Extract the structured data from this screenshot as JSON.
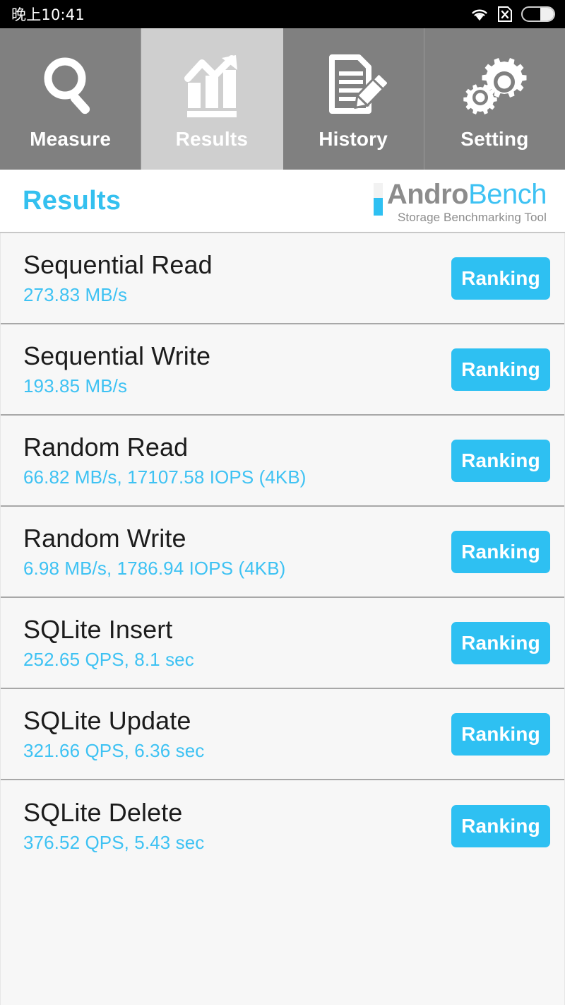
{
  "status_bar": {
    "clock": "晚上10:41",
    "icons": [
      "wifi-icon",
      "no-sim-icon",
      "battery-icon"
    ],
    "background": "#000000"
  },
  "tabs": [
    {
      "label": "Measure",
      "icon": "magnifier-icon",
      "selected": false
    },
    {
      "label": "Results",
      "icon": "bar-chart-arrow-icon",
      "selected": true
    },
    {
      "label": "History",
      "icon": "document-pencil-icon",
      "selected": false
    },
    {
      "label": "Setting",
      "icon": "gears-icon",
      "selected": false
    }
  ],
  "header": {
    "title": "Results",
    "brand_primary": "Andro",
    "brand_secondary": "Bench",
    "brand_subtitle": "Storage Benchmarking Tool"
  },
  "results": [
    {
      "name": "Sequential Read",
      "value": "273.83 MB/s",
      "button": "Ranking"
    },
    {
      "name": "Sequential Write",
      "value": "193.85 MB/s",
      "button": "Ranking"
    },
    {
      "name": "Random Read",
      "value": "66.82 MB/s, 17107.58 IOPS (4KB)",
      "button": "Ranking"
    },
    {
      "name": "Random Write",
      "value": "6.98 MB/s, 1786.94 IOPS (4KB)",
      "button": "Ranking"
    },
    {
      "name": "SQLite Insert",
      "value": "252.65 QPS, 8.1 sec",
      "button": "Ranking"
    },
    {
      "name": "SQLite Update",
      "value": "321.66 QPS, 6.36 sec",
      "button": "Ranking"
    },
    {
      "name": "SQLite Delete",
      "value": "376.52 QPS, 5.43 sec",
      "button": "Ranking"
    }
  ],
  "colors": {
    "accent": "#2ec0f2",
    "accent_text": "#3ec2f3",
    "tab_inactive": "#808080",
    "tab_active": "#cfcfcf",
    "row_background": "#f7f7f7",
    "title_text": "#1c1c1c",
    "brand_gray": "#8c8c8c"
  }
}
